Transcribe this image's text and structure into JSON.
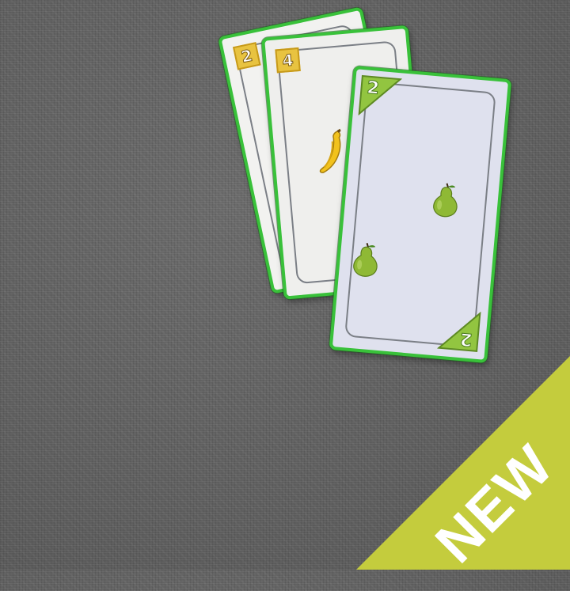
{
  "cards": [
    {
      "value": "2",
      "marker_style": "square",
      "marker_color": "#e8c340"
    },
    {
      "value": "4",
      "marker_style": "square",
      "marker_color": "#e8c340",
      "fruit": "banana"
    },
    {
      "value": "2",
      "marker_style": "triangle",
      "marker_color": "#92c540",
      "fruit": "pear",
      "fruit_count": 2
    }
  ],
  "card_border_color": "#39c13a",
  "badge": {
    "label": "NEW",
    "color": "#c4cc3d"
  }
}
